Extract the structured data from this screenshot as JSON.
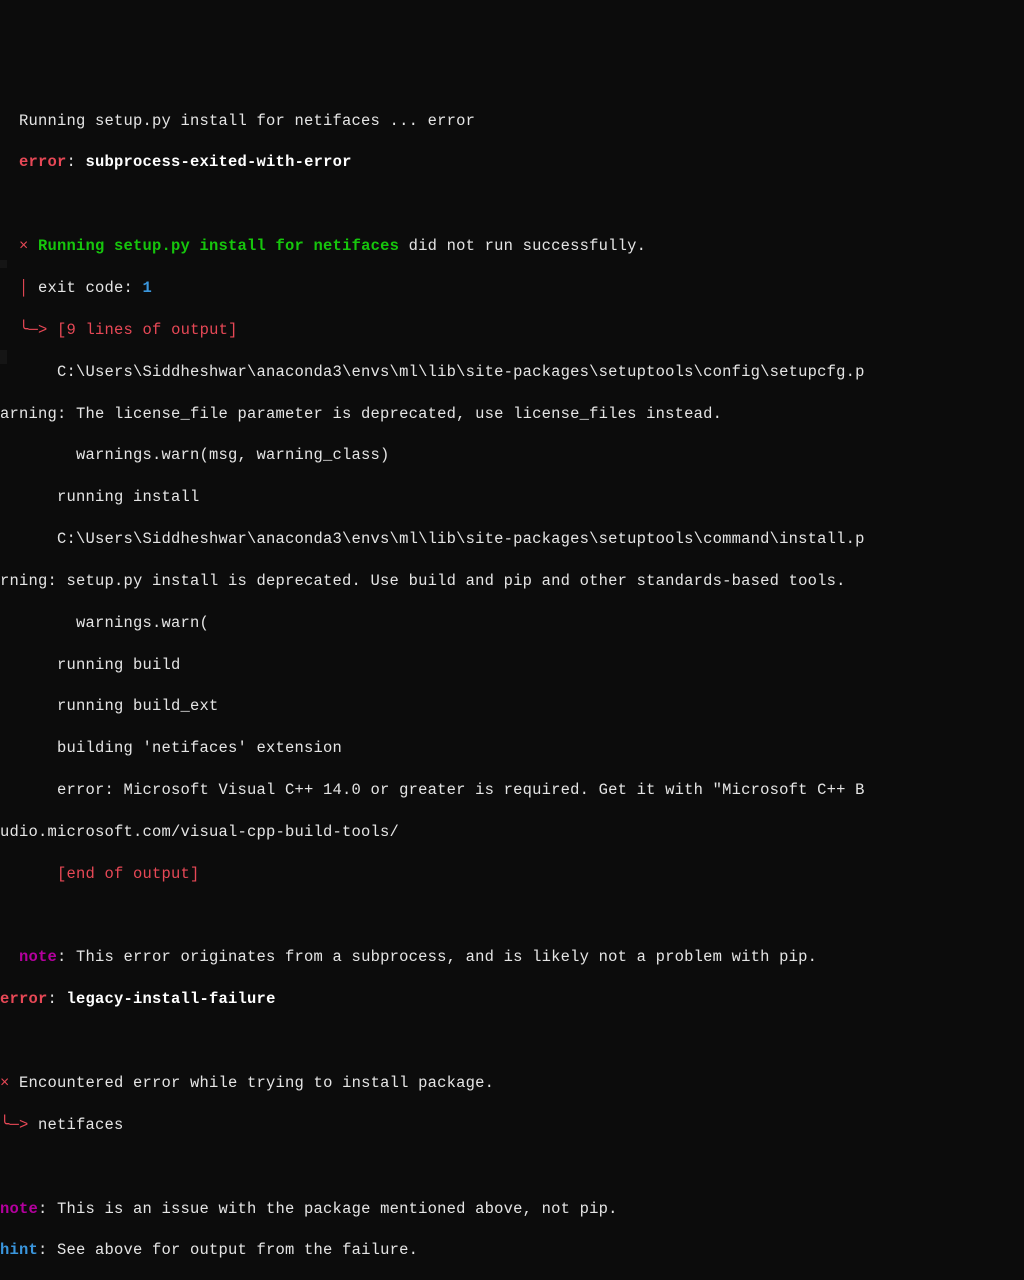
{
  "colors": {
    "bg": "#0c0c0c",
    "white": "#e5e5e5",
    "bold_white": "#ffffff",
    "red": "#e74856",
    "green": "#16c60c",
    "cyan": "#61d6d6",
    "magenta": "#b4009e",
    "blue": "#3b78ff"
  },
  "l01_a": "  Running setup.py install for netifaces ... ",
  "l01_b": "error",
  "l02_a": "  error",
  "l02_b": ": ",
  "l02_c": "subprocess-exited-with-error",
  "blank": "  ",
  "l04_a": "  × ",
  "l04_b": "Running setup.py install for netifaces",
  "l04_c": " did not run successfully.",
  "l05_a": "  │ ",
  "l05_b": "exit code: ",
  "l05_c": "1",
  "l06_a": "  ╰─> ",
  "l06_b": "[9 lines of output]",
  "l07": "      C:\\Users\\Siddheshwar\\anaconda3\\envs\\ml\\lib\\site-packages\\setuptools\\config\\setupcfg.p",
  "l08": "arning: The license_file parameter is deprecated, use license_files instead.",
  "l09": "        warnings.warn(msg, warning_class)",
  "l10": "      running install",
  "l11": "      C:\\Users\\Siddheshwar\\anaconda3\\envs\\ml\\lib\\site-packages\\setuptools\\command\\install.p",
  "l12": "rning: setup.py install is deprecated. Use build and pip and other standards-based tools.",
  "l13": "        warnings.warn(",
  "l14": "      running build",
  "l15": "      running build_ext",
  "l16": "      building 'netifaces' extension",
  "l17": "      error: Microsoft Visual C++ 14.0 or greater is required. Get it with \"Microsoft C++ B",
  "l18": "udio.microsoft.com/visual-cpp-build-tools/",
  "l19": "      [end of output]",
  "l21_a": "  note",
  "l21_b": ": This error originates from a subprocess, and is likely not a problem with pip.",
  "l22_a": "error",
  "l22_b": ": ",
  "l22_c": "legacy-install-failure",
  "l24_a": "× ",
  "l24_b": "Encountered error while trying to install package.",
  "l25_a": "╰─> ",
  "l25_b": "netifaces",
  "l27_a": "note",
  "l27_b": ": This is an issue with the package mentioned above, not pip.",
  "l28_a": "hint",
  "l28_b": ": See above for output from the failure."
}
